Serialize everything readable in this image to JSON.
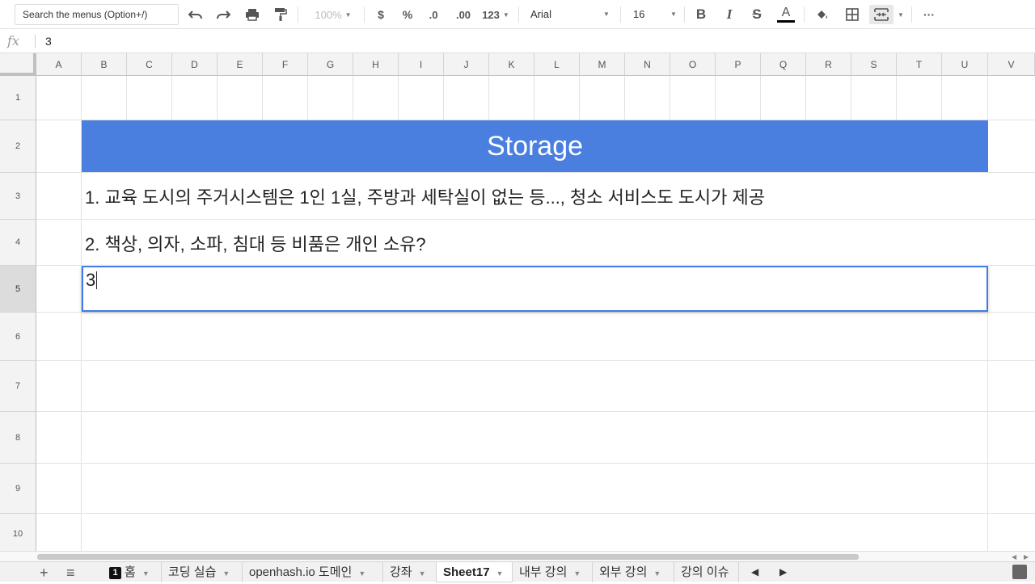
{
  "toolbar": {
    "search_placeholder": "Search the menus (Option+/)",
    "zoom": "100%",
    "currency": "$",
    "percent": "%",
    "dec_decrease": ".0",
    "dec_increase": ".00",
    "more_formats": "123",
    "font_family": "Arial",
    "font_size": "16",
    "bold": "B",
    "italic": "I",
    "strike": "S",
    "text_color": "A",
    "more": "···"
  },
  "formula_bar": {
    "fx_label": "fx",
    "value": "3"
  },
  "columns": [
    "A",
    "B",
    "C",
    "D",
    "E",
    "F",
    "G",
    "H",
    "I",
    "J",
    "K",
    "L",
    "M",
    "N",
    "O",
    "P",
    "Q",
    "R",
    "S",
    "T",
    "U",
    "V"
  ],
  "rows": [
    "1",
    "2",
    "3",
    "4",
    "5",
    "6",
    "7",
    "8",
    "9",
    "10"
  ],
  "selected_row": "5",
  "cells": {
    "banner": "Storage",
    "row3": "1. 교육 도시의 주거시스템은 1인 1실, 주방과 세탁실이 없는 등..., 청소 서비스도 도시가 제공",
    "row4": "2. 책상, 의자, 소파, 침대 등 비품은 개인 소유?",
    "row5_editing": "3"
  },
  "colors": {
    "banner_bg": "#4a7fe0",
    "selection_border": "#3f7ee8"
  },
  "sheet_tabs": [
    {
      "badge": "1",
      "label": "홈"
    },
    {
      "label": "코딩 실습"
    },
    {
      "label": "openhash.io 도메인"
    },
    {
      "label": "강좌"
    },
    {
      "label": "Sheet17",
      "active": true
    },
    {
      "label": "내부 강의"
    },
    {
      "label": "외부 강의"
    },
    {
      "label": "강의 이슈"
    }
  ],
  "tabbar": {
    "add_icon": "+",
    "list_icon": "≡"
  }
}
